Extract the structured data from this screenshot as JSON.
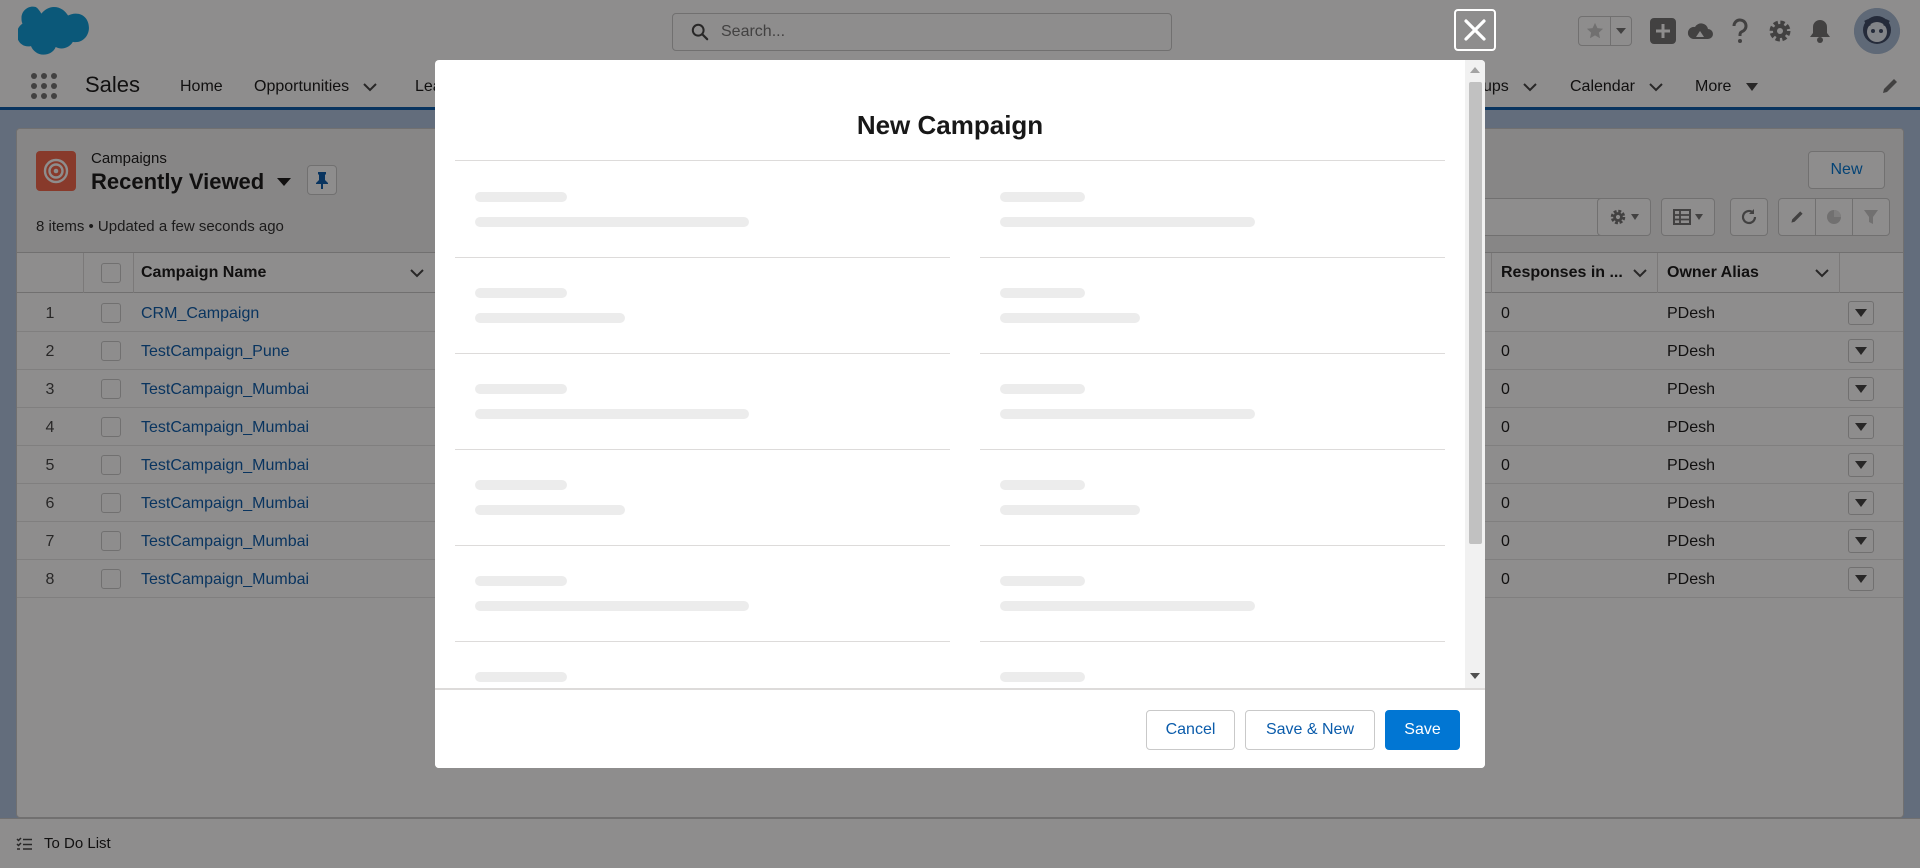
{
  "header": {
    "search_placeholder": "Search..."
  },
  "nav": {
    "app_name": "Sales",
    "items": [
      {
        "label": "Home"
      },
      {
        "label": "Opportunities"
      },
      {
        "label": "Lea"
      },
      {
        "label": "ups"
      },
      {
        "label": "Calendar"
      },
      {
        "label": "More"
      }
    ]
  },
  "list_view": {
    "object_name": "Campaigns",
    "view_name": "Recently Viewed",
    "meta": "8 items • Updated a few seconds ago",
    "new_button": "New",
    "columns": {
      "campaign_name": "Campaign Name",
      "responses": "Responses in ...",
      "owner_alias": "Owner Alias"
    },
    "rows": [
      {
        "num": "1",
        "name": "CRM_Campaign",
        "responses": "0",
        "owner": "PDesh"
      },
      {
        "num": "2",
        "name": "TestCampaign_Pune",
        "responses": "0",
        "owner": "PDesh"
      },
      {
        "num": "3",
        "name": "TestCampaign_Mumbai",
        "responses": "0",
        "owner": "PDesh"
      },
      {
        "num": "4",
        "name": "TestCampaign_Mumbai",
        "responses": "0",
        "owner": "PDesh"
      },
      {
        "num": "5",
        "name": "TestCampaign_Mumbai",
        "responses": "0",
        "owner": "PDesh"
      },
      {
        "num": "6",
        "name": "TestCampaign_Mumbai",
        "responses": "0",
        "owner": "PDesh"
      },
      {
        "num": "7",
        "name": "TestCampaign_Mumbai",
        "responses": "0",
        "owner": "PDesh"
      },
      {
        "num": "8",
        "name": "TestCampaign_Mumbai",
        "responses": "0",
        "owner": "PDesh"
      }
    ]
  },
  "utility_bar": {
    "todo_label": "To Do List"
  },
  "modal": {
    "title": "New Campaign",
    "state": "loading",
    "buttons": {
      "cancel": "Cancel",
      "save_new": "Save & New",
      "save": "Save"
    }
  },
  "colors": {
    "brand": "#0176d3",
    "link": "#0b5cab",
    "campaign_icon": "#f4664a",
    "backdrop": "rgba(8,7,7,0.46)"
  }
}
